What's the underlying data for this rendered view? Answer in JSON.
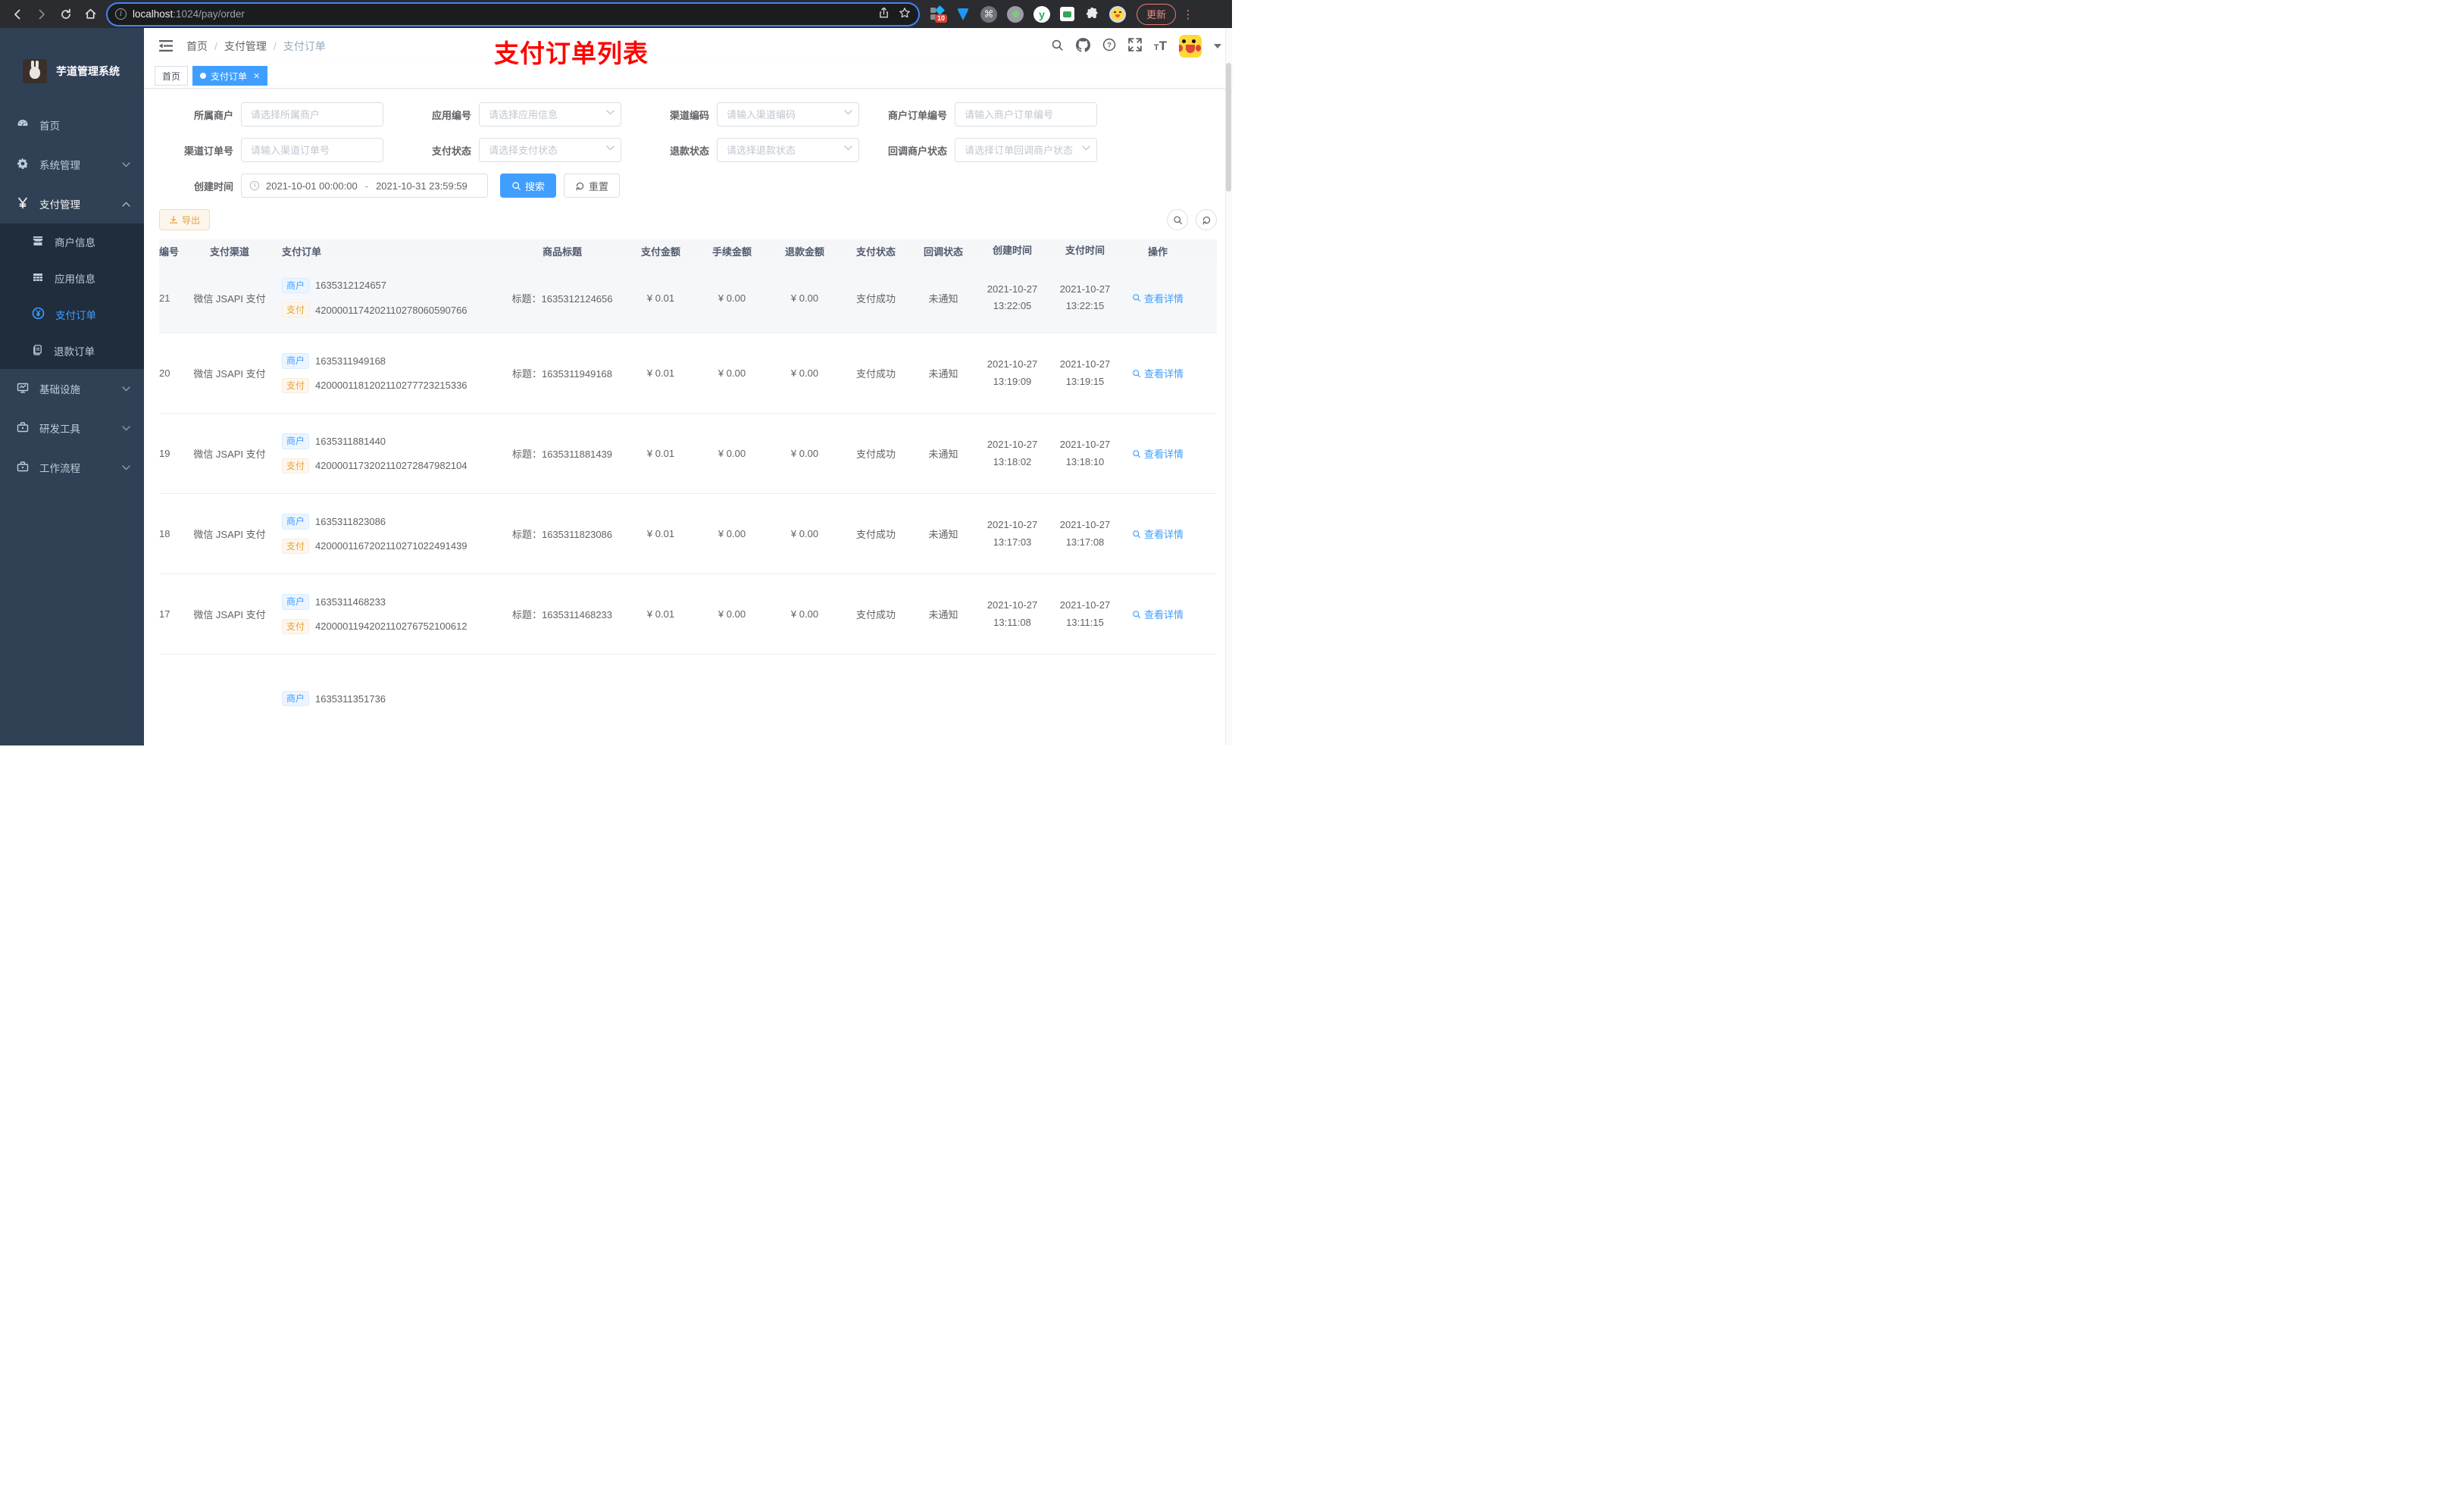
{
  "browser": {
    "url_host": "localhost",
    "url_rest": ":1024/pay/order",
    "ext_badge": "10",
    "update_label": "更新"
  },
  "colors": {
    "accent": "#409EFF",
    "warning": "#E6A23C",
    "annotation_red": "#FE0400",
    "sidebar_bg": "#304156",
    "submenu_bg": "#1F2D3D",
    "tag_active": "#409EFF"
  },
  "sidebar": {
    "title": "芋道管理系统",
    "menu": [
      {
        "label": "首页"
      },
      {
        "label": "系统管理"
      },
      {
        "label": "支付管理",
        "children": [
          {
            "label": "商户信息"
          },
          {
            "label": "应用信息"
          },
          {
            "label": "支付订单"
          },
          {
            "label": "退款订单"
          }
        ]
      },
      {
        "label": "基础设施"
      },
      {
        "label": "研发工具"
      },
      {
        "label": "工作流程"
      }
    ]
  },
  "navbar": {
    "breadcrumb": [
      "首页",
      "支付管理",
      "支付订单"
    ],
    "annotation": "支付订单列表"
  },
  "tags": [
    {
      "label": "首页"
    },
    {
      "label": "支付订单"
    }
  ],
  "filters": {
    "rows": [
      [
        {
          "label": "所属商户",
          "placeholder": "请选择所属商户"
        },
        {
          "label": "应用编号",
          "placeholder": "请选择应用信息"
        },
        {
          "label": "渠道编码",
          "placeholder": "请输入渠道编码"
        },
        {
          "label": "商户订单编号",
          "placeholder": "请输入商户订单编号"
        }
      ],
      [
        {
          "label": "渠道订单号",
          "placeholder": "请输入渠道订单号"
        },
        {
          "label": "支付状态",
          "placeholder": "请选择支付状态"
        },
        {
          "label": "退款状态",
          "placeholder": "请选择退款状态"
        },
        {
          "label": "回调商户状态",
          "placeholder": "请选择订单回调商户状态"
        }
      ]
    ],
    "date": {
      "label": "创建时间",
      "start": "2021-10-01 00:00:00",
      "separator": "-",
      "end": "2021-10-31 23:59:59"
    },
    "search_label": "搜索",
    "reset_label": "重置"
  },
  "toolbar": {
    "export_label": "导出"
  },
  "table": {
    "headers": [
      "编号",
      "支付渠道",
      "支付订单",
      "商品标题",
      "支付金额",
      "手续金额",
      "退款金额",
      "支付状态",
      "回调状态",
      "创建时间",
      "支付时间",
      "操作"
    ],
    "badge_merchant": "商户",
    "badge_pay": "支付",
    "title_prefix": "标题：",
    "action_label": "查看详情",
    "rows": [
      {
        "id": "21",
        "channel": "微信 JSAPI 支付",
        "merchant_no": "1635312124657",
        "pay_no": "4200001174202110278060590766",
        "title": "1635312124656",
        "amount": "¥ 0.01",
        "fee": "¥ 0.00",
        "refund": "¥ 0.00",
        "status": "支付成功",
        "notify": "未通知",
        "created": "2021-10-27 13:22:05",
        "paid": "2021-10-27 13:22:15"
      },
      {
        "id": "20",
        "channel": "微信 JSAPI 支付",
        "merchant_no": "1635311949168",
        "pay_no": "4200001181202110277723215336",
        "title": "1635311949168",
        "amount": "¥ 0.01",
        "fee": "¥ 0.00",
        "refund": "¥ 0.00",
        "status": "支付成功",
        "notify": "未通知",
        "created": "2021-10-27 13:19:09",
        "paid": "2021-10-27 13:19:15"
      },
      {
        "id": "19",
        "channel": "微信 JSAPI 支付",
        "merchant_no": "1635311881440",
        "pay_no": "4200001173202110272847982104",
        "title": "1635311881439",
        "amount": "¥ 0.01",
        "fee": "¥ 0.00",
        "refund": "¥ 0.00",
        "status": "支付成功",
        "notify": "未通知",
        "created": "2021-10-27 13:18:02",
        "paid": "2021-10-27 13:18:10"
      },
      {
        "id": "18",
        "channel": "微信 JSAPI 支付",
        "merchant_no": "1635311823086",
        "pay_no": "4200001167202110271022491439",
        "title": "1635311823086",
        "amount": "¥ 0.01",
        "fee": "¥ 0.00",
        "refund": "¥ 0.00",
        "status": "支付成功",
        "notify": "未通知",
        "created": "2021-10-27 13:17:03",
        "paid": "2021-10-27 13:17:08"
      },
      {
        "id": "17",
        "channel": "微信 JSAPI 支付",
        "merchant_no": "1635311468233",
        "pay_no": "4200001194202110276752100612",
        "title": "1635311468233",
        "amount": "¥ 0.01",
        "fee": "¥ 0.00",
        "refund": "¥ 0.00",
        "status": "支付成功",
        "notify": "未通知",
        "created": "2021-10-27 13:11:08",
        "paid": "2021-10-27 13:11:15"
      }
    ],
    "partial_row": {
      "merchant_no": "1635311351736"
    }
  }
}
